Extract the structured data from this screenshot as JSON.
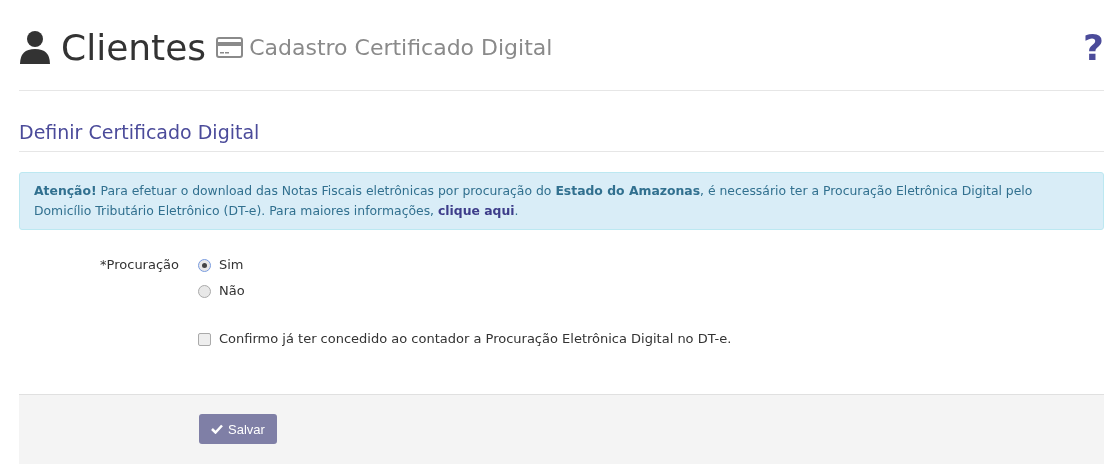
{
  "header": {
    "title": "Clientes",
    "subtitle": "Cadastro Certificado Digital",
    "help": "?"
  },
  "section": {
    "title": "Definir Certificado Digital"
  },
  "alert": {
    "text": "**Atenção!** Para efetuar o download das Notas Fiscais eletrônicas por procuração do **Estado do Amazonas**, é necessário ter a Procuração Eletrônica Digital pelo Domicílio Tributário Eletrônico (DT-e). Para maiores informações,",
    "link": "clique aqui",
    "suffix": "."
  },
  "form": {
    "label": "*Procuração",
    "options": [
      {
        "label": "Sim",
        "selected": true
      },
      {
        "label": "Não",
        "selected": false
      }
    ],
    "confirm": {
      "label": "Confirmo já ter concedido ao contador a Procuração Eletrônica Digital no DT-e.",
      "checked": false
    }
  },
  "footer": {
    "button": "Salvar"
  }
}
